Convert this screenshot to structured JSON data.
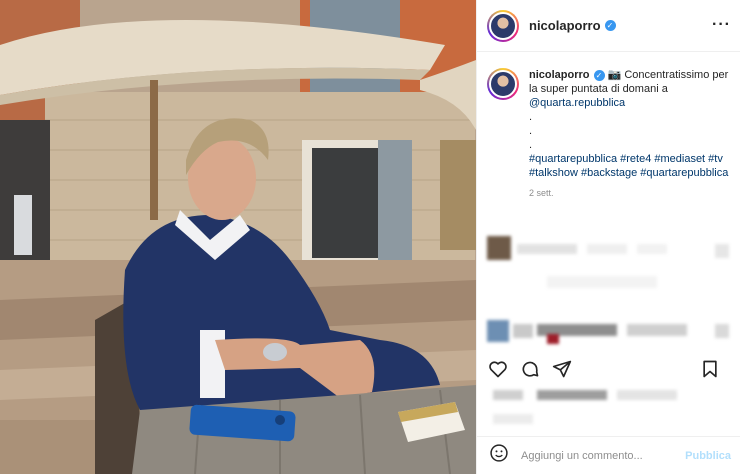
{
  "post": {
    "username": "nicolaporro",
    "verified_icon": "verified-badge-icon",
    "more_icon": "more-options-icon"
  },
  "caption": {
    "username": "nicolaporro",
    "camera_emoji": "📷",
    "text_line1": "Concentratissimo per la super puntata di domani a",
    "mention": "@quarta.repubblica",
    "dots": [
      ".",
      ".",
      "."
    ],
    "hashtags": "#quartarepubblica #rete4 #mediaset #tv #talkshow #backstage #quartarepubblica",
    "time": "2 sett."
  },
  "actions": {
    "like_icon": "heart-icon",
    "comment_icon": "comment-icon",
    "share_icon": "share-icon",
    "save_icon": "bookmark-icon"
  },
  "comment_box": {
    "emoji_icon": "emoji-icon",
    "placeholder": "Aggiungi un commento...",
    "publish_label": "Pubblica"
  },
  "colors": {
    "link": "#00376b",
    "verified": "#3897f0",
    "publish_disabled": "#b2dffc",
    "muted": "#8e8e8e"
  }
}
